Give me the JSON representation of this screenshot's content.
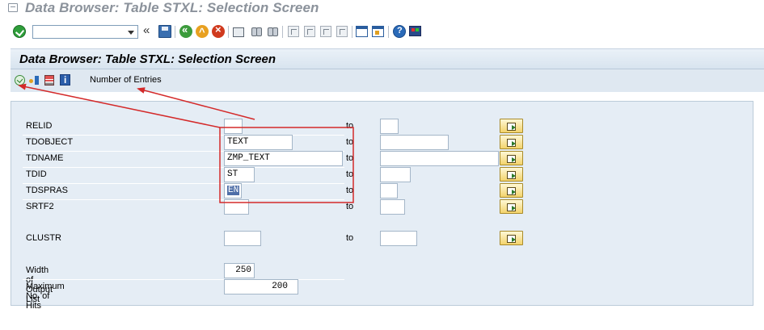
{
  "window": {
    "title": "Data Browser: Table STXL: Selection Screen"
  },
  "system_toolbar": {
    "command_field_value": "",
    "icons": [
      "check-icon",
      "command-field",
      "collapse-icon",
      "save-icon",
      "back-icon",
      "exit-icon",
      "cancel-icon",
      "print-icon",
      "find-icon",
      "find-next-icon",
      "first-page-icon",
      "previous-page-icon",
      "next-page-icon",
      "last-page-icon",
      "new-session-icon",
      "shortcut-icon",
      "help-icon",
      "layout-icon"
    ]
  },
  "page": {
    "title": "Data Browser: Table STXL: Selection Screen"
  },
  "app_toolbar": {
    "icons": [
      "execute-icon",
      "selection-options-icon",
      "delete-entries-icon",
      "info-icon"
    ],
    "number_of_entries_label": "Number of Entries"
  },
  "selection": {
    "to_label": "to",
    "fields": [
      {
        "label": "RELID",
        "low": "",
        "high": ""
      },
      {
        "label": "TDOBJECT",
        "low": "TEXT",
        "high": ""
      },
      {
        "label": "TDNAME",
        "low": "ZMP_TEXT",
        "high": ""
      },
      {
        "label": "TDID",
        "low": "ST",
        "high": ""
      },
      {
        "label": "TDSPRAS",
        "low": "EN",
        "high": ""
      },
      {
        "label": "SRTF2",
        "low": "",
        "high": ""
      },
      {
        "label": "CLUSTR",
        "low": "",
        "high": ""
      }
    ],
    "width_of_output_list": {
      "label": "Width of Output List",
      "value": "250"
    },
    "maximum_no_of_hits": {
      "label": "Maximum No. of Hits",
      "value": "200"
    }
  },
  "colors": {
    "annotation_red": "#d42a2a",
    "header_band": "#dae5f0",
    "panel": "#e5edf5",
    "multiple_selection_button": "#f3d36b"
  }
}
